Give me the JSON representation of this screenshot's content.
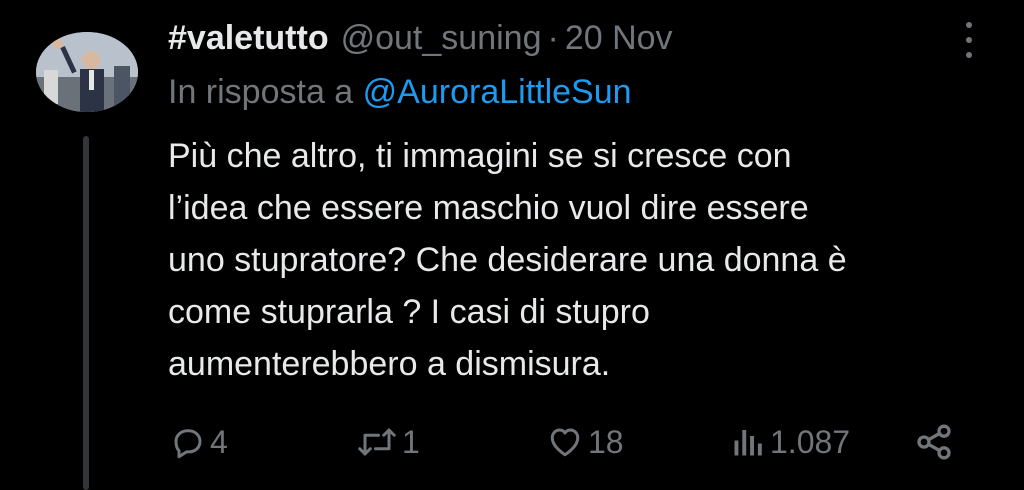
{
  "tweet": {
    "display_name": "#valetutto",
    "handle": "@out_suning",
    "separator": "·",
    "date": "20 Nov",
    "reply_prefix": "In risposta a",
    "reply_to": "@AuroraLittleSun",
    "text": "Più che altro, ti immagini se si cresce con\nl’idea  che essere maschio vuol dire  essere\nuno stupratore? Che desiderare una donna è\ncome stuprarla ? I casi di stupro\naumenterebbero a dismisura."
  },
  "actions": {
    "replies": "4",
    "retweets": "1",
    "likes": "18",
    "views": "1.087"
  },
  "icons": [
    "reply-icon",
    "retweet-icon",
    "like-icon",
    "views-icon",
    "share-icon",
    "more-icon"
  ],
  "colors": {
    "background": "#000000",
    "text": "#e7e9ea",
    "muted": "#71767b",
    "link": "#1d9bf0"
  }
}
